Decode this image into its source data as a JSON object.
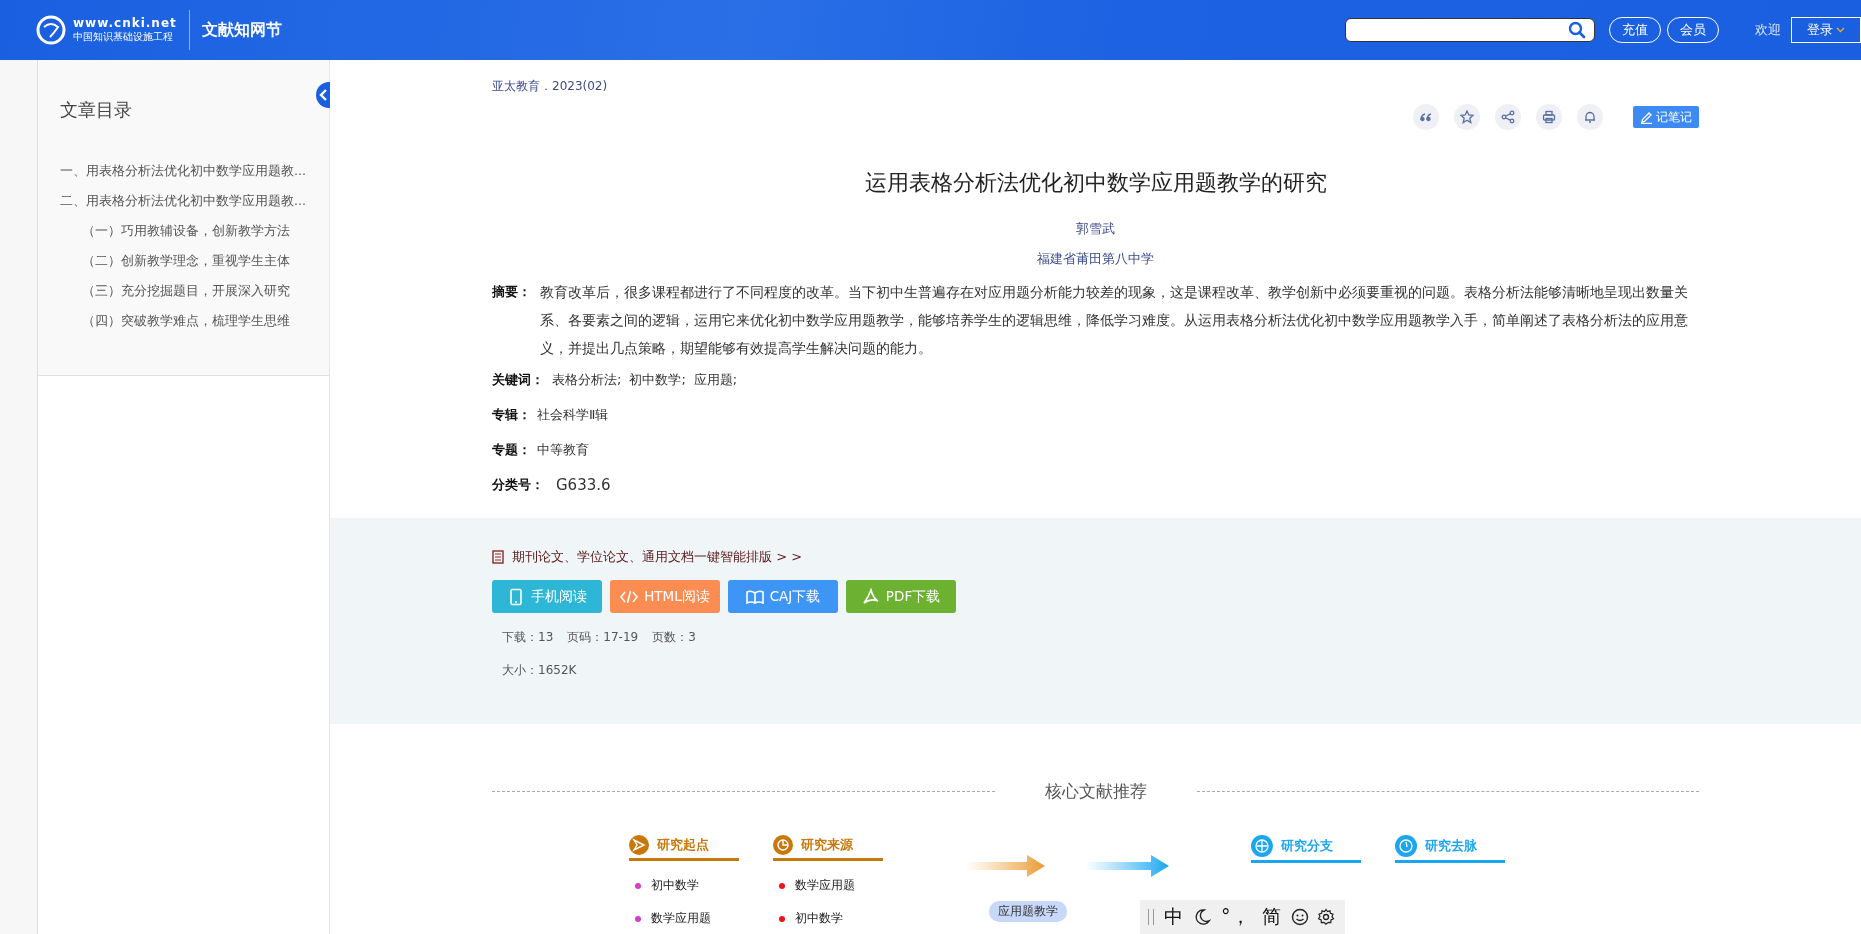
{
  "header": {
    "logo_text": "www.cnki.net",
    "logo_subtitle": "中国知识基础设施工程",
    "site_name": "文献知网节",
    "buttons": [
      "充值",
      "会员"
    ],
    "welcome": "欢迎",
    "login": "登录"
  },
  "sidebar": {
    "title": "文章目录",
    "toc": [
      {
        "label": "一、用表格分析法优化初中数学应用题教..."
      },
      {
        "label": "二、用表格分析法优化初中数学应用题教...",
        "children": [
          {
            "label": "（一）巧用教辅设备，创新教学方法"
          },
          {
            "label": "（二）创新教学理念，重视学生主体"
          },
          {
            "label": "（三）充分挖掘题目，开展深入研究"
          },
          {
            "label": "（四）突破教学难点，梳理学生思维"
          }
        ]
      }
    ]
  },
  "article": {
    "source": "亚太教育．2023(02)",
    "tools": [
      {
        "kind": "quote"
      },
      {
        "kind": "star"
      },
      {
        "kind": "share"
      },
      {
        "kind": "print"
      },
      {
        "kind": "bell"
      }
    ],
    "note_button": "记笔记",
    "title": "运用表格分析法优化初中数学应用题教学的研究",
    "author": "郭雪武",
    "affiliation": "福建省莆田第八中学",
    "abstract_label": "摘要：",
    "abstract": "教育改革后，很多课程都进行了不同程度的改革。当下初中生普遍存在对应用题分析能力较差的现象，这是课程改革、教学创新中必须要重视的问题。表格分析法能够清晰地呈现出数量关系、各要素之间的逻辑，运用它来优化初中数学应用题教学，能够培养学生的逻辑思维，降低学习难度。从运用表格分析法优化初中数学应用题教学入手，简单阐述了表格分析法的应用意义，并提出几点策略，期望能够有效提高学生解决问题的能力。",
    "keywords_label": "关键词：",
    "keywords": [
      "表格分析法;",
      "初中数学;",
      "应用题;"
    ],
    "fields": [
      {
        "label": "专辑：",
        "value": "社会科学Ⅱ辑"
      },
      {
        "label": "专题：",
        "value": "中等教育"
      },
      {
        "label": "分类号：",
        "value": "G633.6"
      }
    ]
  },
  "download": {
    "promo": "期刊论文、学位论文、通用文档一键智能排版 > >",
    "buttons": [
      {
        "kind": "mobile",
        "label": "手机阅读",
        "color": "#2eb6d6"
      },
      {
        "kind": "html",
        "label": "HTML阅读",
        "color": "#fb8c52"
      },
      {
        "kind": "caj",
        "label": "CAJ下载",
        "color": "#3d96f5"
      },
      {
        "kind": "pdf",
        "label": "PDF下载",
        "color": "#6cb130"
      }
    ],
    "stats": [
      "下载：13",
      "页码：17-19",
      "页数：3"
    ],
    "size": "大小：1652K"
  },
  "recommend": {
    "title": "核心文献推荐",
    "groups": [
      {
        "label": "研究起点",
        "kind": "send",
        "color": "#c8780a",
        "items": [
          {
            "label": "初中数学",
            "color": "#d63cc8"
          },
          {
            "label": "数学应用题",
            "color": "#d63cc8"
          }
        ]
      },
      {
        "label": "研究来源",
        "kind": "pie",
        "color": "#c8780a",
        "items": [
          {
            "label": "数学应用题",
            "color": "#e8141b"
          },
          {
            "label": "初中数学",
            "color": "#e8141b"
          }
        ]
      },
      {
        "label": "研究分支",
        "kind": "plus",
        "color": "#1aa6f0"
      },
      {
        "label": "研究去脉",
        "kind": "clock",
        "color": "#1aa6f0"
      }
    ],
    "center_tag": "应用题教学"
  },
  "ime_bar": [
    "中",
    "°，",
    "简"
  ]
}
